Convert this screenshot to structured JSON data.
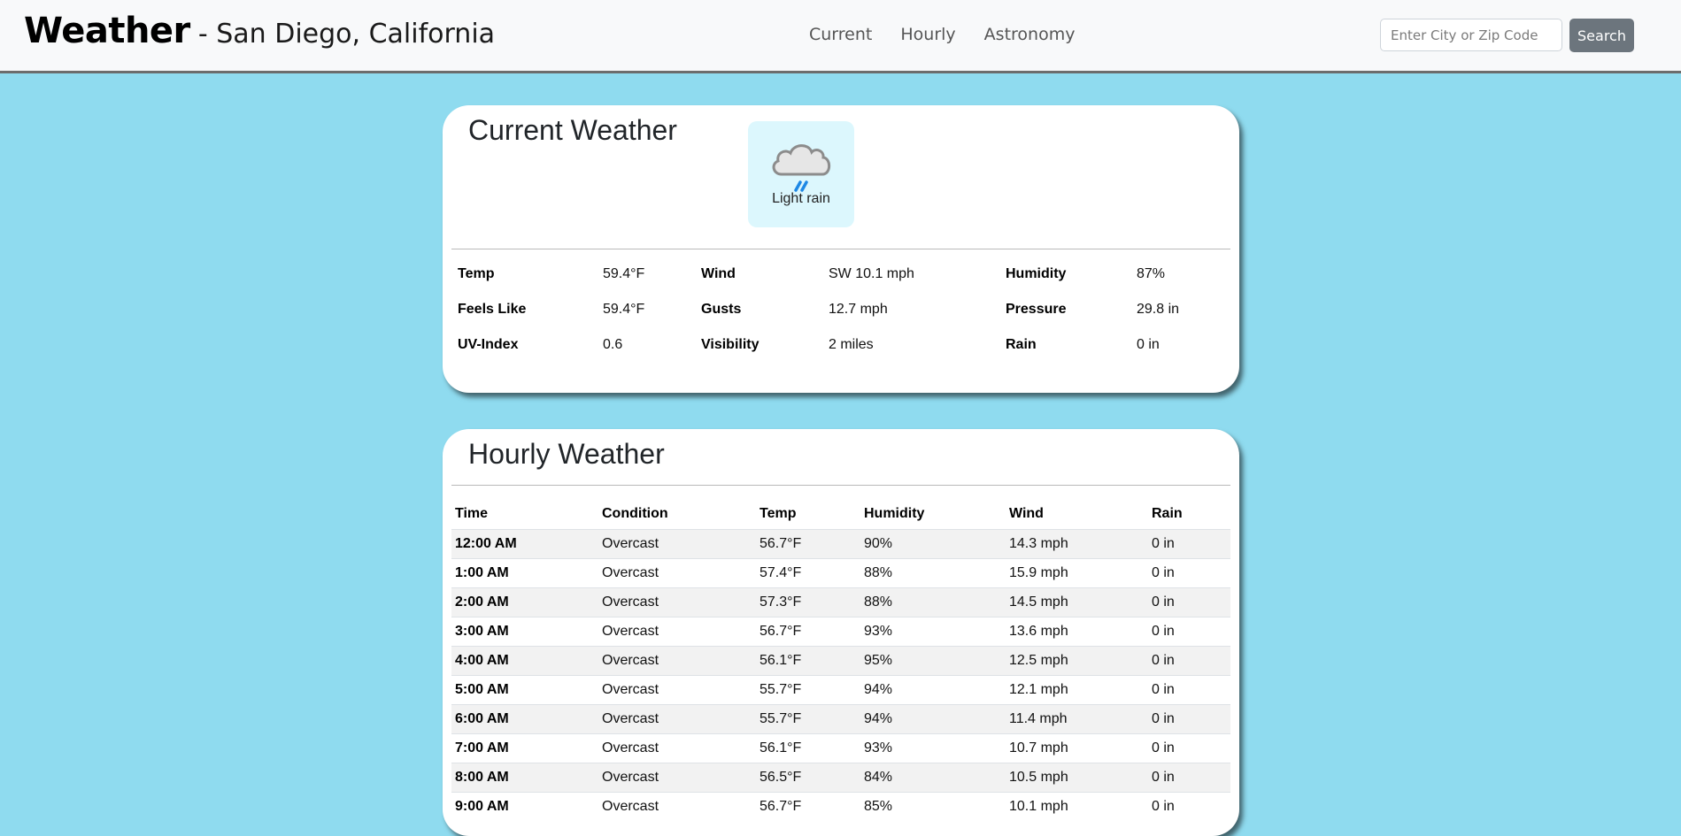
{
  "header": {
    "title": "Weather",
    "location": "- San Diego, California",
    "nav": [
      "Current",
      "Hourly",
      "Astronomy"
    ],
    "search_placeholder": "Enter City or Zip Code",
    "search_button": "Search"
  },
  "current": {
    "title": "Current Weather",
    "condition": "Light rain",
    "condition_icon": "rain-cloud-icon",
    "rows": [
      [
        {
          "label": "Temp",
          "value": "59.4°F"
        },
        {
          "label": "Wind",
          "value": "SW 10.1 mph"
        },
        {
          "label": "Humidity",
          "value": "87%"
        }
      ],
      [
        {
          "label": "Feels Like",
          "value": "59.4°F"
        },
        {
          "label": "Gusts",
          "value": "12.7 mph"
        },
        {
          "label": "Pressure",
          "value": "29.8 in"
        }
      ],
      [
        {
          "label": "UV-Index",
          "value": "0.6"
        },
        {
          "label": "Visibility",
          "value": "2 miles"
        },
        {
          "label": "Rain",
          "value": "0 in"
        }
      ]
    ]
  },
  "hourly": {
    "title": "Hourly Weather",
    "columns": [
      "Time",
      "Condition",
      "Temp",
      "Humidity",
      "Wind",
      "Rain"
    ],
    "rows": [
      [
        "12:00 AM",
        "Overcast",
        "56.7°F",
        "90%",
        "14.3 mph",
        "0 in"
      ],
      [
        "1:00 AM",
        "Overcast",
        "57.4°F",
        "88%",
        "15.9 mph",
        "0 in"
      ],
      [
        "2:00 AM",
        "Overcast",
        "57.3°F",
        "88%",
        "14.5 mph",
        "0 in"
      ],
      [
        "3:00 AM",
        "Overcast",
        "56.7°F",
        "93%",
        "13.6 mph",
        "0 in"
      ],
      [
        "4:00 AM",
        "Overcast",
        "56.1°F",
        "95%",
        "12.5 mph",
        "0 in"
      ],
      [
        "5:00 AM",
        "Overcast",
        "55.7°F",
        "94%",
        "12.1 mph",
        "0 in"
      ],
      [
        "6:00 AM",
        "Overcast",
        "55.7°F",
        "94%",
        "11.4 mph",
        "0 in"
      ],
      [
        "7:00 AM",
        "Overcast",
        "56.1°F",
        "93%",
        "10.7 mph",
        "0 in"
      ],
      [
        "8:00 AM",
        "Overcast",
        "56.5°F",
        "84%",
        "10.5 mph",
        "0 in"
      ],
      [
        "9:00 AM",
        "Overcast",
        "56.7°F",
        "85%",
        "10.1 mph",
        "0 in"
      ]
    ]
  },
  "colors": {
    "background": "#8fdbef",
    "navbar": "#f8f9fa",
    "search_button": "#6c757d",
    "condition_box": "#dcf7fd",
    "rain_drops": "#1e88e5"
  }
}
